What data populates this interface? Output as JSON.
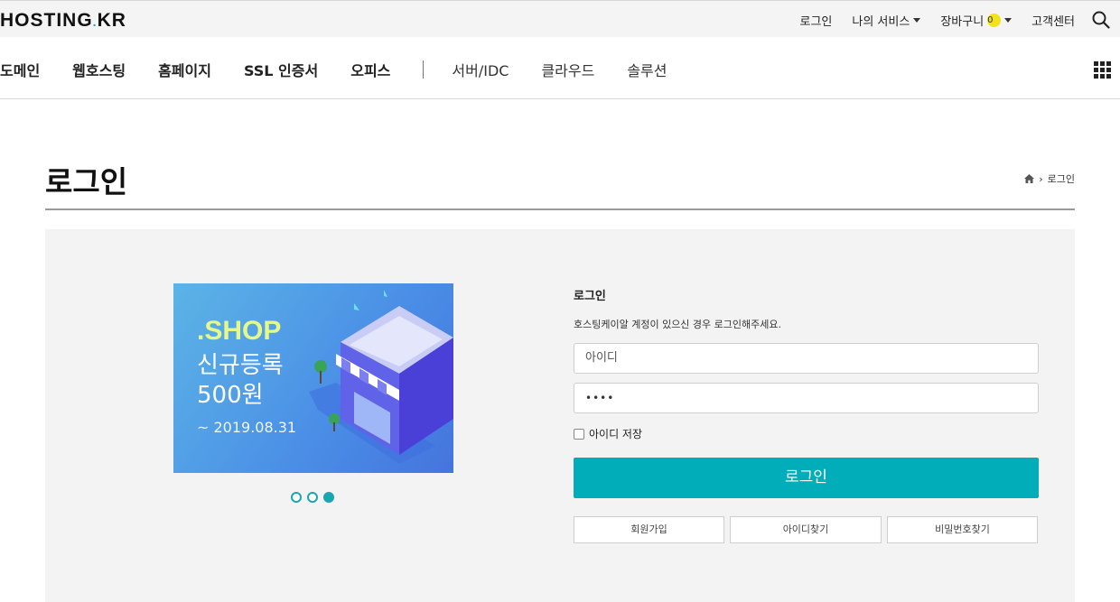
{
  "header": {
    "logo": "HOSTING",
    "logo_dot": ".",
    "logo_tld": "KR",
    "util_links": {
      "login": "로그인",
      "my_services": "나의 서비스",
      "cart": "장바구니",
      "cart_count": "0",
      "support": "고객센터"
    }
  },
  "nav": {
    "items": [
      "도메인",
      "웹호스팅",
      "홈페이지",
      "SSL 인증서",
      "오피스"
    ],
    "items_secondary": [
      "서버/IDC",
      "클라우드",
      "솔루션"
    ]
  },
  "page": {
    "title": "로그인",
    "breadcrumb": "로그인"
  },
  "banner": {
    "line1": ".SHOP",
    "line2": "신규등록",
    "line3": "500원",
    "line4": "~ 2019.08.31",
    "slides_total": 3,
    "active_slide": 3
  },
  "login": {
    "title": "로그인",
    "description": "호스팅케이알 계정이 있으신 경우 로그인해주세요.",
    "id_placeholder": "아이디",
    "password_value": "••••",
    "remember_label": "아이디 저장",
    "remember_checked": false,
    "submit_label": "로그인",
    "signup_label": "회원가입",
    "find_id_label": "아이디찾기",
    "find_password_label": "비밀번호찾기"
  },
  "colors": {
    "accent": "#00adb9",
    "badge": "#f2e318",
    "panel_bg": "#f3f3f3"
  }
}
